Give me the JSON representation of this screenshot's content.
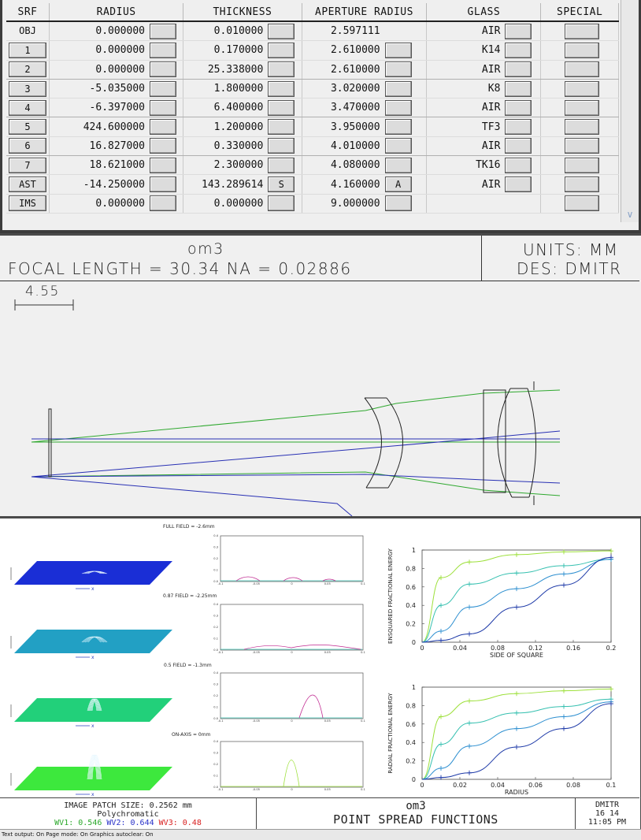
{
  "lens_table": {
    "headers": [
      "SRF",
      "RADIUS",
      "THICKNESS",
      "APERTURE RADIUS",
      "GLASS",
      "SPECIAL"
    ],
    "rows": [
      {
        "srf": "OBJ",
        "radius": "0.000000",
        "thickness": "0.010000",
        "thick_btn": "",
        "aperture": "2.597111",
        "ap_btn": null,
        "glass": "AIR"
      },
      {
        "srf": "1",
        "radius": "0.000000",
        "thickness": "0.170000",
        "thick_btn": "",
        "aperture": "2.610000",
        "ap_btn": "",
        "glass": "K14"
      },
      {
        "srf": "2",
        "radius": "0.000000",
        "thickness": "25.338000",
        "thick_btn": "",
        "aperture": "2.610000",
        "ap_btn": "",
        "glass": "AIR"
      },
      {
        "srf": "3",
        "radius": "-5.035000",
        "thickness": "1.800000",
        "thick_btn": "",
        "aperture": "3.020000",
        "ap_btn": "",
        "glass": "K8"
      },
      {
        "srf": "4",
        "radius": "-6.397000",
        "thickness": "6.400000",
        "thick_btn": "",
        "aperture": "3.470000",
        "ap_btn": "",
        "glass": "AIR"
      },
      {
        "srf": "5",
        "radius": "424.600000",
        "thickness": "1.200000",
        "thick_btn": "",
        "aperture": "3.950000",
        "ap_btn": "",
        "glass": "TF3"
      },
      {
        "srf": "6",
        "radius": "16.827000",
        "thickness": "0.330000",
        "thick_btn": "",
        "aperture": "4.010000",
        "ap_btn": "",
        "glass": "AIR"
      },
      {
        "srf": "7",
        "radius": "18.621000",
        "thickness": "2.300000",
        "thick_btn": "",
        "aperture": "4.080000",
        "ap_btn": "",
        "glass": "TK16"
      },
      {
        "srf": "AST",
        "radius": "-14.250000",
        "thickness": "143.289614",
        "thick_btn": "S",
        "aperture": "4.160000",
        "ap_btn": "A",
        "glass": "AIR"
      },
      {
        "srf": "IMS",
        "radius": "0.000000",
        "thickness": "0.000000",
        "thick_btn": "",
        "aperture": "9.000000",
        "ap_btn": "",
        "glass": null
      }
    ]
  },
  "layout": {
    "title": "om3",
    "focal_line": "FOCAL LENGTH = 30.34   NA = 0.02886",
    "units": "UNITS: MM",
    "designer": "DES: DMITR",
    "scale_label": "4.55"
  },
  "psf": {
    "field_labels": [
      "FULL FIELD = -2.6mm",
      "0.87 FIELD = -2.25mm",
      "0.5 FIELD = -1.3mm",
      "ON-AXIS = 0mm"
    ],
    "mini_yticks": [
      "0.0",
      "0.1",
      "0.2",
      "0.3",
      "0.4"
    ],
    "mini_xticks": [
      "-0.1",
      "-0.05",
      "0",
      "0.05",
      "0.1"
    ],
    "ensquared_ylabel": "ENSQUARED FRACTIONAL ENERGY",
    "ensquared_xlabel": "SIDE OF SQUARE",
    "ensquared_xticks": [
      "0",
      "0.04",
      "0.08",
      "0.12",
      "0.16",
      "0.2"
    ],
    "radial_ylabel": "RADIAL FRACTIONAL ENERGY",
    "radial_xlabel": "RADIUS",
    "radial_xticks": [
      "0",
      "0.02",
      "0.04",
      "0.06",
      "0.08",
      "0.1"
    ],
    "energy_yticks": [
      "0",
      "0.2",
      "0.4",
      "0.6",
      "0.8",
      "1"
    ],
    "patch_size": "IMAGE PATCH SIZE: 0.2562 mm",
    "poly": "Polychromatic",
    "wv1": "WV1: 0.546",
    "wv2": "WV2: 0.644",
    "wv3": "WV3: 0.48",
    "title": "om3",
    "subtitle": "POINT SPREAD FUNCTIONS",
    "designer": "DMITR",
    "date": "16  14",
    "time": "11:05 PM"
  },
  "colors": {
    "ray_green": "#2ea82e",
    "ray_blue": "#2830b4",
    "surface_blue": "#1a2ed6",
    "surface_teal": "#22a0c4",
    "surface_green": "#22d07a",
    "surface_lime": "#3de83d",
    "curve_lime": "#9de03a",
    "curve_teal": "#36c0b0",
    "curve_cyan": "#2d8fd0",
    "curve_navy": "#1e3aa8",
    "magenta": "#c02890"
  },
  "status_bar": "Text output: On Page mode: On  Graphics autoclear: On",
  "ensquared_data": {
    "x": [
      0,
      0.02,
      0.05,
      0.1,
      0.15,
      0.2
    ],
    "series": [
      [
        0,
        0.7,
        0.87,
        0.95,
        0.98,
        0.99
      ],
      [
        0,
        0.4,
        0.63,
        0.75,
        0.83,
        0.9
      ],
      [
        0,
        0.12,
        0.38,
        0.58,
        0.74,
        0.9
      ],
      [
        0,
        0.02,
        0.09,
        0.38,
        0.62,
        0.92
      ]
    ]
  },
  "radial_data": {
    "x": [
      0,
      0.01,
      0.025,
      0.05,
      0.075,
      0.1
    ],
    "series": [
      [
        0,
        0.68,
        0.85,
        0.93,
        0.96,
        0.98
      ],
      [
        0,
        0.38,
        0.61,
        0.72,
        0.79,
        0.87
      ],
      [
        0,
        0.12,
        0.36,
        0.55,
        0.68,
        0.84
      ],
      [
        0,
        0.02,
        0.07,
        0.35,
        0.55,
        0.82
      ]
    ]
  }
}
